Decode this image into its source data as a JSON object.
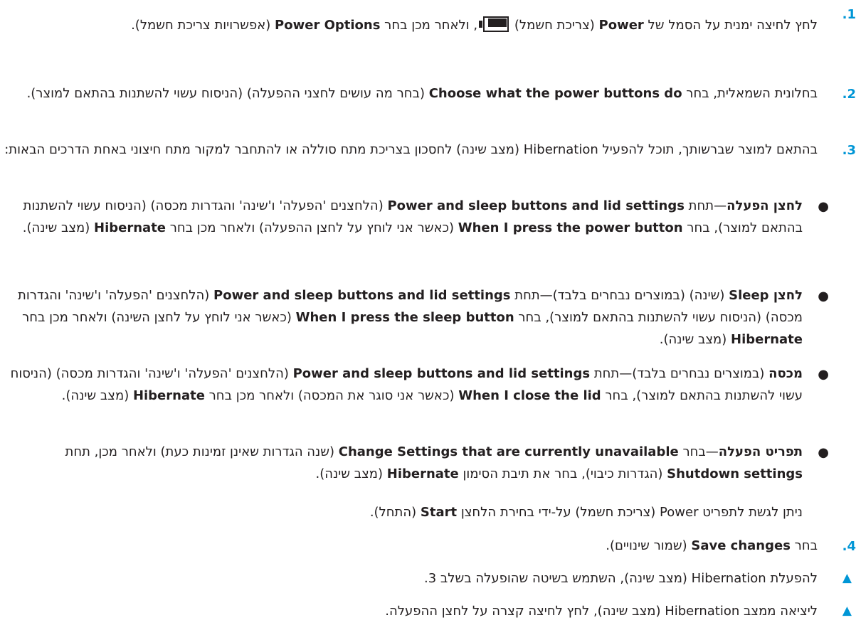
{
  "colors": {
    "accent": "#0096d6",
    "text": "#231f20"
  },
  "steps": [
    {
      "num": "1.",
      "t1": "לחץ לחיצה ימנית על הסמל של ",
      "b1": "Power",
      "t2": " (צריכת חשמל) ",
      "icon": "battery-icon",
      "t3": ", ולאחר מכן בחר ",
      "b2": "Power Options",
      "t4": " (אפשרויות צריכת חשמל)."
    },
    {
      "num": "2.",
      "t1": "בחלונית השמאלית, בחר ",
      "b1": "Choose what the power buttons do",
      "t2": " (בחר מה עושים לחצני ההפעלה) (הניסוח עשוי להשתנות בהתאם למוצר)."
    },
    {
      "num": "3.",
      "t1": "בהתאם למוצר שברשותך, תוכל להפעיל Hibernation (מצב שינה) לחסכון בצריכת מתח סוללה או להתחבר למקור מתח חיצוני באחת הדרכים הבאות:"
    },
    {
      "num": "4.",
      "t1": "בחר ",
      "b1": "Save changes",
      "t2": " (שמור שינויים)."
    }
  ],
  "bullets": [
    {
      "b1": "לחצן הפעלה",
      "t1": "—תחת ",
      "b2": "Power and sleep buttons and lid settings",
      "t2": " (הלחצנים 'הפעלה' ו'שינה' והגדרות מכסה) (הניסוח עשוי להשתנות בהתאם למוצר), בחר ",
      "b3": "When I press the power button",
      "t3": " (כאשר אני לוחץ על לחצן ההפעלה) ולאחר מכן בחר ",
      "b4": "Hibernate",
      "t4": " (מצב שינה)."
    },
    {
      "b1": "לחצן Sleep",
      "t1": " (שינה) (במוצרים נבחרים בלבד)—תחת ",
      "b2": "Power and sleep buttons and lid settings",
      "t2": " (הלחצנים 'הפעלה' ו'שינה' והגדרות מכסה) (הניסוח עשוי להשתנות בהתאם למוצר), בחר ",
      "b3": "When I press the sleep button",
      "t3": " (כאשר אני לוחץ על לחצן השינה) ולאחר מכן בחר ",
      "b4": "Hibernate",
      "t4": " (מצב שינה)."
    },
    {
      "b1": "מכסה",
      "t1": " (במוצרים נבחרים בלבד)—תחת ",
      "b2": "Power and sleep buttons and lid settings",
      "t2": " (הלחצנים 'הפעלה' ו'שינה' והגדרות מכסה) (הניסוח עשוי להשתנות בהתאם למוצר), בחר ",
      "b3": "When I close the lid",
      "t3": " (כאשר אני סוגר את המכסה) ולאחר מכן בחר ",
      "b4": "Hibernate",
      "t4": " (מצב שינה)."
    },
    {
      "b1": "תפריט הפעלה",
      "t1": "—בחר ",
      "b2": "Change Settings that are currently unavailable",
      "t2": " (שנה הגדרות שאינן זמינות כעת) ולאחר מכן, תחת ",
      "b3": "Shutdown settings",
      "t3": " (הגדרות כיבוי), בחר את תיבת הסימון ",
      "b4": "Hibernate",
      "t4": " (מצב שינה)."
    }
  ],
  "note": {
    "t1": "ניתן לגשת לתפריט Power (צריכת חשמל) על-ידי בחירת הלחצן ",
    "b1": "Start",
    "t2": " (התחל)."
  },
  "tips": [
    {
      "marker": "▲",
      "text": "להפעלת Hibernation (מצב שינה), השתמש בשיטה שהופעלה בשלב 3."
    },
    {
      "marker": "▲",
      "text": "ליציאה ממצב Hibernation (מצב שינה), לחץ לחיצה קצרה על לחצן ההפעלה."
    }
  ]
}
